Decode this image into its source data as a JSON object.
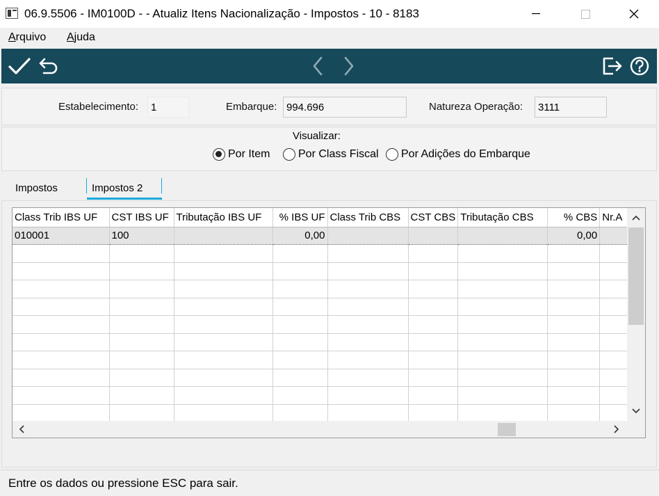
{
  "window": {
    "title": "06.9.5506 - IM0100D -  - Atualiz Itens Nacionalização - Impostos - 10 - 8183"
  },
  "menu": {
    "items": [
      {
        "label_first": "A",
        "label_rest": "rquivo"
      },
      {
        "label_first": "A",
        "label_rest": "juda"
      }
    ]
  },
  "toolbar": {
    "accent_color": "#16495a",
    "icons": [
      "check-icon",
      "undo-icon",
      "chevron-left-icon",
      "chevron-right-icon",
      "exit-icon",
      "help-icon"
    ]
  },
  "header": {
    "estabelecimento_label": "Estabelecimento:",
    "estabelecimento_value": "1",
    "embarque_label": "Embarque:",
    "embarque_value": "994.696",
    "natureza_label": "Natureza Operação:",
    "natureza_value": "3111"
  },
  "visualizar": {
    "label": "Visualizar:",
    "options": [
      {
        "label": "Por Item",
        "checked": true
      },
      {
        "label": "Por Class Fiscal",
        "checked": false
      },
      {
        "label": "Por Adições do Embarque",
        "checked": false
      }
    ]
  },
  "tabs": [
    {
      "label": "Impostos",
      "active": false
    },
    {
      "label": "Impostos 2",
      "active": true
    }
  ],
  "grid": {
    "columns": [
      "Class Trib IBS UF",
      "CST IBS UF",
      "Tributação IBS UF",
      "% IBS UF",
      "Class Trib CBS",
      "CST CBS",
      "Tributação CBS",
      "% CBS",
      "Nr.A"
    ],
    "rows": [
      [
        "010001",
        "100",
        "",
        "0,00",
        "",
        "",
        "",
        "0,00",
        ""
      ]
    ]
  },
  "status": {
    "message": "Entre os dados ou pressione ESC para sair."
  }
}
